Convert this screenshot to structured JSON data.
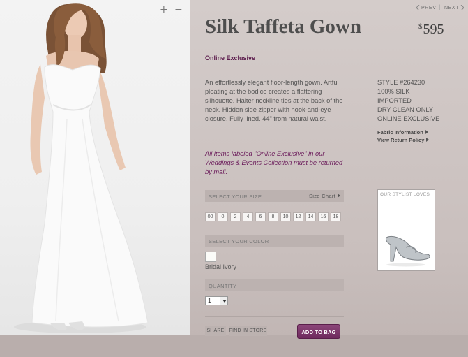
{
  "product": {
    "title": "Silk Taffeta Gown",
    "price_currency": "$",
    "price_value": "595",
    "badge": "Online Exclusive",
    "description": "An effortlessly elegant floor-length gown. Artful pleating at the bodice creates a flattering silhouette. Halter neckline ties at the back of the neck. Hidden side zipper with hook-and-eye closure. Fully lined. 44\" from natural waist.",
    "specs": [
      "STYLE #264230",
      "100% SILK",
      "IMPORTED",
      "DRY CLEAN ONLY",
      "ONLINE EXCLUSIVE"
    ],
    "links": [
      "Fabric Information",
      "View Return Policy"
    ],
    "notice": "All items labeled \"Online Exclusive\" in our Weddings & Events Collection must be returned by mail."
  },
  "nav": {
    "prev": "PREV",
    "next": "NEXT",
    "zoom_in": "+",
    "zoom_out": "−"
  },
  "size_section": {
    "label": "SELECT YOUR SIZE",
    "chart_link": "Size Chart",
    "sizes": [
      "00",
      "0",
      "2",
      "4",
      "6",
      "8",
      "10",
      "12",
      "14",
      "16",
      "18"
    ]
  },
  "color_section": {
    "label": "SELECT YOUR COLOR",
    "selected_color": "Bridal Ivory",
    "swatch_color": "#fbfbf8"
  },
  "quantity_section": {
    "label": "QUANTITY",
    "value": "1"
  },
  "actions": {
    "share": "SHARE",
    "find_in_store": "FIND IN STORE",
    "add_to_bag": "ADD TO BAG"
  },
  "stylist": {
    "label": "OUR STYLIST LOVES"
  },
  "colors": {
    "accent": "#6f2b5e",
    "notice_text": "#6a1a5a"
  }
}
